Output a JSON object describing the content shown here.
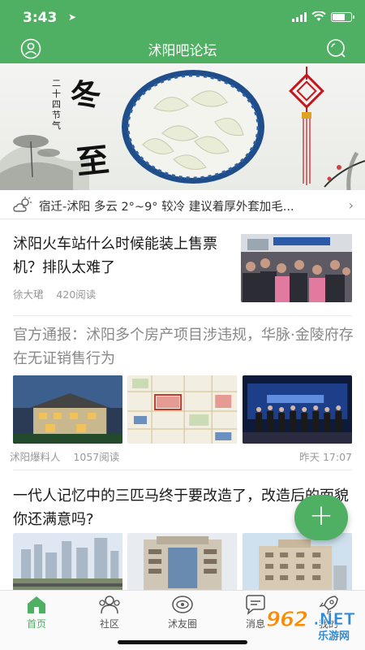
{
  "status_bar": {
    "time": "3:43",
    "location_arrow": "location-arrow-icon",
    "wifi": "wifi-icon",
    "battery": "battery-icon"
  },
  "header": {
    "title": "沭阳吧论坛",
    "left_icon": "user-icon",
    "right_icon": "search-icon",
    "color": "#4faf63"
  },
  "banner": {
    "title": "冬至",
    "subtitle": "二十四节气"
  },
  "weather": {
    "icon": "cloud-sun-icon",
    "text": "宿迁-沭阳 多云 2°~9° 较冷 建议着厚外套加毛...",
    "chevron": "›"
  },
  "feed": [
    {
      "title": "沭阳火车站什么时候能装上售票机？排队太难了",
      "author": "徐大珺",
      "reads": "420阅读",
      "images": 1
    },
    {
      "title": "官方通报：沭阳多个房产项目涉违规，华脉·金陵府存在无证销售行为",
      "author": "沭阳爆料人",
      "reads": "1057阅读",
      "time": "昨天 17:07",
      "images": 3
    },
    {
      "title": "一代人记忆中的三匹马终于要改造了，改造后的面貌你还满意吗?",
      "images": 3
    }
  ],
  "fab": {
    "label": "+"
  },
  "tabbar": {
    "active_color": "#4faf63",
    "tabs": [
      {
        "label": "首页",
        "icon": "home-icon",
        "active": true
      },
      {
        "label": "社区",
        "icon": "community-icon",
        "active": false
      },
      {
        "label": "沭友圈",
        "icon": "eye-circle-icon",
        "active": false
      },
      {
        "label": "消息",
        "icon": "message-icon",
        "active": false
      },
      {
        "label": "我的",
        "icon": "rocket-icon",
        "active": false
      }
    ]
  },
  "watermark": {
    "number": "962",
    "suffix": ".NET",
    "sub": "乐游网"
  }
}
